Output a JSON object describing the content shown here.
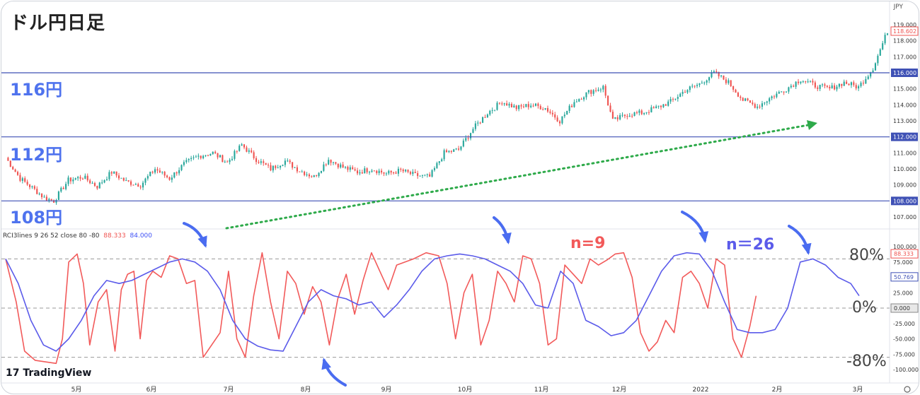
{
  "title": "ドル円日足",
  "currency": "JPY",
  "level_labels": [
    "116円",
    "112円",
    "108円"
  ],
  "price_axis": {
    "ticks": [
      "119.000",
      "118.000",
      "117.000",
      "116.000",
      "115.000",
      "114.000",
      "113.000",
      "112.000",
      "111.000",
      "110.000",
      "109.000",
      "108.000",
      "107.000"
    ],
    "current_price": "118.602",
    "highlight_levels": [
      "116.000",
      "112.000",
      "108.000"
    ]
  },
  "osc_axis": {
    "ticks": [
      "100.000",
      "75.000",
      "50.000",
      "25.000",
      "0.000",
      "-25.000",
      "-50.000",
      "-75.000",
      "-100.000"
    ],
    "rci9_value": "88.333",
    "rci26_value": "50.769",
    "zero_value": "0.000"
  },
  "indicator_label": {
    "name": "RCI3lines 9 26 52 close 80 -80",
    "rci9": "88.333",
    "rci26": "84.000"
  },
  "annotations": {
    "n9": "n=9",
    "n26": "n＝26",
    "pct80": "80%",
    "pct0": "0%",
    "pct_neg80": "-80%"
  },
  "month_labels": [
    "5月",
    "6月",
    "7月",
    "8月",
    "9月",
    "10月",
    "11月",
    "12月",
    "2022",
    "2月",
    "3月"
  ],
  "branding": "TradingView",
  "colors": {
    "up": "#26a69a",
    "down": "#ef5350",
    "level_line": "#3f51b5",
    "rci_short": "#f25a5a",
    "rci_long": "#5b5bea",
    "trend_arrow": "#2eaa4a",
    "callout_arrow": "#4a6cf0"
  },
  "chart_data": [
    {
      "type": "candlestick",
      "title": "ドル円日足",
      "ylim": [
        106.5,
        119.3
      ],
      "x_months": [
        "5月",
        "6月",
        "7月",
        "8月",
        "9月",
        "10月",
        "11月",
        "12月",
        "2022",
        "2月",
        "3月"
      ],
      "horizontal_levels": [
        116,
        112,
        108
      ],
      "anchor_closes": [
        [
          0,
          110.7
        ],
        [
          6,
          109.4
        ],
        [
          12,
          108.7
        ],
        [
          16,
          108.2
        ],
        [
          20,
          108.0
        ],
        [
          26,
          109.3
        ],
        [
          32,
          109.5
        ],
        [
          38,
          108.9
        ],
        [
          44,
          109.8
        ],
        [
          50,
          109.2
        ],
        [
          56,
          109.0
        ],
        [
          62,
          110.0
        ],
        [
          68,
          109.4
        ],
        [
          74,
          110.3
        ],
        [
          80,
          110.8
        ],
        [
          86,
          111.0
        ],
        [
          92,
          110.4
        ],
        [
          98,
          111.5
        ],
        [
          104,
          110.6
        ],
        [
          110,
          110.0
        ],
        [
          116,
          110.5
        ],
        [
          122,
          109.9
        ],
        [
          128,
          109.5
        ],
        [
          134,
          110.6
        ],
        [
          140,
          110.1
        ],
        [
          146,
          109.8
        ],
        [
          152,
          110.0
        ],
        [
          158,
          109.7
        ],
        [
          164,
          109.9
        ],
        [
          170,
          109.6
        ],
        [
          176,
          109.5
        ],
        [
          182,
          111.0
        ],
        [
          188,
          111.2
        ],
        [
          194,
          112.5
        ],
        [
          200,
          113.5
        ],
        [
          206,
          114.2
        ],
        [
          212,
          113.8
        ],
        [
          218,
          114.0
        ],
        [
          224,
          113.8
        ],
        [
          230,
          113.0
        ],
        [
          236,
          114.2
        ],
        [
          242,
          114.8
        ],
        [
          248,
          115.1
        ],
        [
          252,
          113.0
        ],
        [
          258,
          113.4
        ],
        [
          264,
          113.5
        ],
        [
          270,
          113.8
        ],
        [
          276,
          114.2
        ],
        [
          282,
          114.9
        ],
        [
          288,
          115.3
        ],
        [
          294,
          116.0
        ],
        [
          300,
          115.4
        ],
        [
          306,
          114.3
        ],
        [
          312,
          113.9
        ],
        [
          318,
          114.5
        ],
        [
          324,
          115.0
        ],
        [
          330,
          115.6
        ],
        [
          336,
          115.2
        ],
        [
          342,
          115.0
        ],
        [
          348,
          115.4
        ],
        [
          354,
          115.1
        ],
        [
          360,
          116.3
        ],
        [
          366,
          118.6
        ]
      ]
    },
    {
      "type": "line",
      "title": "RCI3lines 9 26 52 close 80 -80",
      "ylim": [
        -100,
        100
      ],
      "reference_lines": [
        80,
        0,
        -80
      ],
      "series": [
        {
          "name": "n=9",
          "values": [
            [
              0,
              80
            ],
            [
              5,
              10
            ],
            [
              9,
              -70
            ],
            [
              14,
              -85
            ],
            [
              20,
              -88
            ],
            [
              24,
              -90
            ],
            [
              27,
              -50
            ],
            [
              30,
              75
            ],
            [
              34,
              88
            ],
            [
              37,
              40
            ],
            [
              40,
              -60
            ],
            [
              44,
              10
            ],
            [
              48,
              30
            ],
            [
              52,
              -70
            ],
            [
              55,
              30
            ],
            [
              58,
              55
            ],
            [
              61,
              60
            ],
            [
              64,
              -50
            ],
            [
              67,
              45
            ],
            [
              70,
              60
            ],
            [
              74,
              50
            ],
            [
              78,
              85
            ],
            [
              82,
              80
            ],
            [
              86,
              40
            ],
            [
              90,
              45
            ],
            [
              94,
              -80
            ],
            [
              98,
              -60
            ],
            [
              102,
              -40
            ],
            [
              106,
              60
            ],
            [
              110,
              -50
            ],
            [
              114,
              -80
            ],
            [
              118,
              20
            ],
            [
              122,
              90
            ],
            [
              126,
              10
            ],
            [
              130,
              -50
            ],
            [
              134,
              60
            ],
            [
              138,
              40
            ],
            [
              142,
              -10
            ],
            [
              146,
              35
            ],
            [
              150,
              10
            ],
            [
              154,
              -60
            ],
            [
              158,
              15
            ],
            [
              162,
              55
            ],
            [
              166,
              -10
            ],
            [
              170,
              45
            ],
            [
              174,
              90
            ],
            [
              178,
              60
            ],
            [
              182,
              30
            ],
            [
              186,
              70
            ],
            [
              190,
              75
            ],
            [
              194,
              80
            ],
            [
              200,
              90
            ],
            [
              206,
              85
            ],
            [
              210,
              40
            ],
            [
              214,
              -50
            ],
            [
              218,
              25
            ],
            [
              222,
              55
            ],
            [
              226,
              -60
            ],
            [
              230,
              -20
            ],
            [
              234,
              60
            ],
            [
              238,
              40
            ],
            [
              242,
              10
            ],
            [
              246,
              85
            ],
            [
              250,
              80
            ],
            [
              254,
              40
            ],
            [
              258,
              -60
            ],
            [
              262,
              -50
            ],
            [
              266,
              70
            ],
            [
              270,
              55
            ],
            [
              274,
              40
            ],
            [
              278,
              80
            ],
            [
              282,
              70
            ],
            [
              286,
              78
            ],
            [
              290,
              88
            ],
            [
              294,
              90
            ],
            [
              298,
              50
            ],
            [
              302,
              -40
            ],
            [
              306,
              -70
            ],
            [
              310,
              -55
            ],
            [
              314,
              -20
            ],
            [
              318,
              -40
            ],
            [
              322,
              50
            ],
            [
              326,
              60
            ],
            [
              330,
              40
            ],
            [
              334,
              0
            ],
            [
              338,
              80
            ],
            [
              342,
              70
            ],
            [
              346,
              -50
            ],
            [
              350,
              -80
            ],
            [
              354,
              -30
            ],
            [
              357,
              20
            ]
          ]
        },
        {
          "name": "n＝26",
          "values": [
            [
              0,
              80
            ],
            [
              6,
              40
            ],
            [
              12,
              -20
            ],
            [
              18,
              -60
            ],
            [
              24,
              -70
            ],
            [
              30,
              -50
            ],
            [
              36,
              -20
            ],
            [
              42,
              20
            ],
            [
              48,
              45
            ],
            [
              54,
              40
            ],
            [
              60,
              45
            ],
            [
              66,
              55
            ],
            [
              72,
              65
            ],
            [
              78,
              75
            ],
            [
              84,
              80
            ],
            [
              90,
              75
            ],
            [
              96,
              60
            ],
            [
              102,
              30
            ],
            [
              108,
              -20
            ],
            [
              114,
              -50
            ],
            [
              120,
              -62
            ],
            [
              126,
              -68
            ],
            [
              132,
              -70
            ],
            [
              138,
              -30
            ],
            [
              144,
              10
            ],
            [
              150,
              30
            ],
            [
              156,
              20
            ],
            [
              162,
              15
            ],
            [
              168,
              5
            ],
            [
              174,
              10
            ],
            [
              180,
              -15
            ],
            [
              186,
              5
            ],
            [
              192,
              30
            ],
            [
              198,
              60
            ],
            [
              204,
              80
            ],
            [
              210,
              85
            ],
            [
              216,
              88
            ],
            [
              222,
              85
            ],
            [
              228,
              80
            ],
            [
              234,
              70
            ],
            [
              240,
              60
            ],
            [
              246,
              40
            ],
            [
              252,
              5
            ],
            [
              258,
              0
            ],
            [
              264,
              60
            ],
            [
              270,
              40
            ],
            [
              276,
              -20
            ],
            [
              282,
              -30
            ],
            [
              288,
              -45
            ],
            [
              294,
              -40
            ],
            [
              300,
              -20
            ],
            [
              306,
              20
            ],
            [
              312,
              60
            ],
            [
              318,
              85
            ],
            [
              324,
              90
            ],
            [
              330,
              88
            ],
            [
              336,
              60
            ],
            [
              342,
              10
            ],
            [
              348,
              -35
            ],
            [
              354,
              -40
            ],
            [
              360,
              -40
            ],
            [
              366,
              -35
            ],
            [
              372,
              0
            ],
            [
              378,
              75
            ],
            [
              384,
              80
            ],
            [
              390,
              70
            ],
            [
              396,
              50
            ],
            [
              402,
              40
            ],
            [
              406,
              20
            ]
          ]
        }
      ]
    }
  ]
}
